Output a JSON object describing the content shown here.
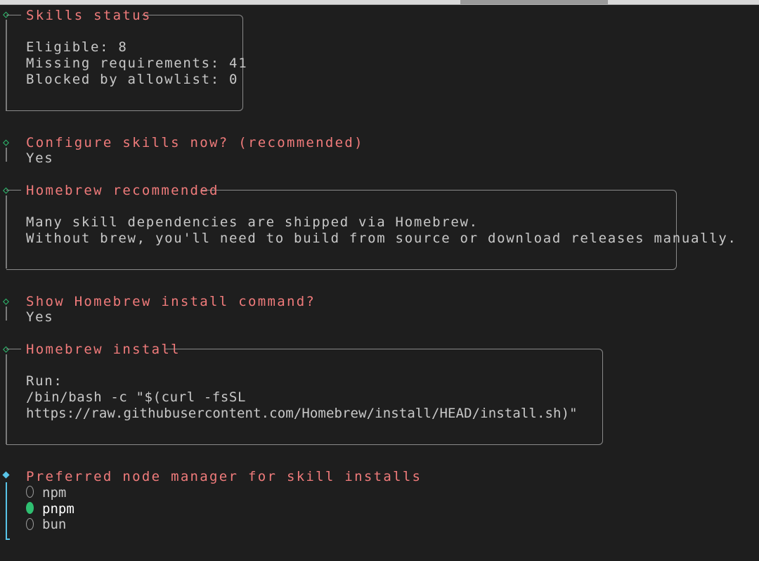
{
  "sections": {
    "skills_status": {
      "title": "Skills status",
      "lines": [
        "Eligible: 8",
        "Missing requirements: 41",
        "Blocked by allowlist: 0"
      ]
    },
    "configure_skills": {
      "title": "Configure skills now? (recommended)",
      "answer": "Yes"
    },
    "homebrew_recommended": {
      "title": "Homebrew recommended",
      "lines": [
        "Many skill dependencies are shipped via Homebrew.",
        "Without brew, you'll need to build from source or download releases manually."
      ]
    },
    "show_install": {
      "title": "Show Homebrew install command?",
      "answer": "Yes"
    },
    "homebrew_install": {
      "title": "Homebrew install",
      "lines": [
        "Run:",
        "/bin/bash -c \"$(curl -fsSL",
        "https://raw.githubusercontent.com/Homebrew/install/HEAD/install.sh)\""
      ]
    },
    "node_manager": {
      "title": "Preferred node manager for skill installs",
      "options": [
        {
          "label": "npm",
          "selected": false
        },
        {
          "label": "pnpm",
          "selected": true
        },
        {
          "label": "bun",
          "selected": false
        }
      ]
    }
  },
  "colors": {
    "heading": "#f07b7b",
    "done_marker": "#2fbf71",
    "active_marker": "#59c4e8",
    "selected_radio": "#2fbf71"
  },
  "icons": {
    "done_marker": "diamond-outline-icon",
    "active_marker": "diamond-filled-icon"
  }
}
